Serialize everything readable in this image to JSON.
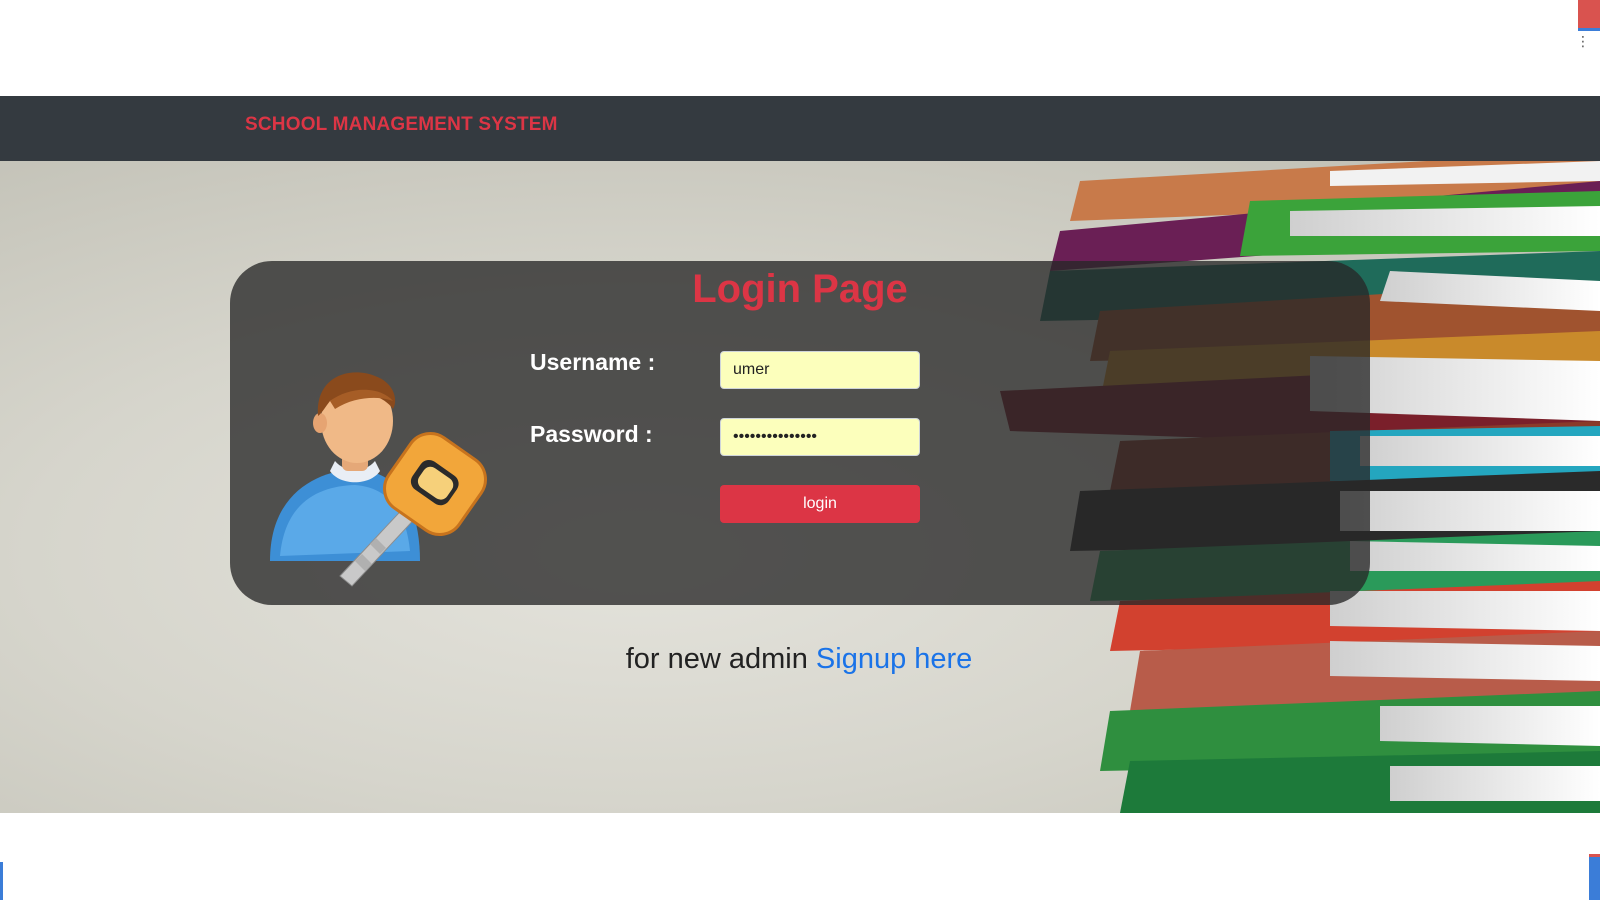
{
  "navbar": {
    "brand": "SCHOOL MANAGEMENT SYSTEM"
  },
  "login": {
    "title": "Login Page",
    "username_label": "Username :",
    "password_label": "Password :",
    "username_value": "umer",
    "password_value": "•••••••••••••••",
    "button_label": "login",
    "avatar_icon": "user-key-icon"
  },
  "signup": {
    "prefix": "for new admin",
    "link_label": "Signup here"
  },
  "colors": {
    "navbar_bg": "#343a40",
    "brand": "#dc3545",
    "title": "#dc3545",
    "button": "#dc3545",
    "input_bg": "#fcffbc",
    "link": "#1a73e8",
    "card_bg": "rgba(40,40,40,0.78)"
  }
}
